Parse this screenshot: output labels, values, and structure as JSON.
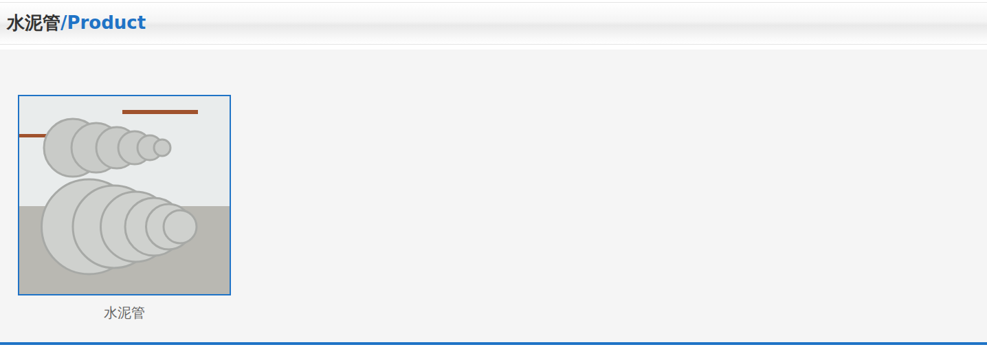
{
  "header": {
    "title": "水泥管",
    "subtitle": "/Product"
  },
  "products": [
    {
      "name": "水泥管"
    }
  ]
}
